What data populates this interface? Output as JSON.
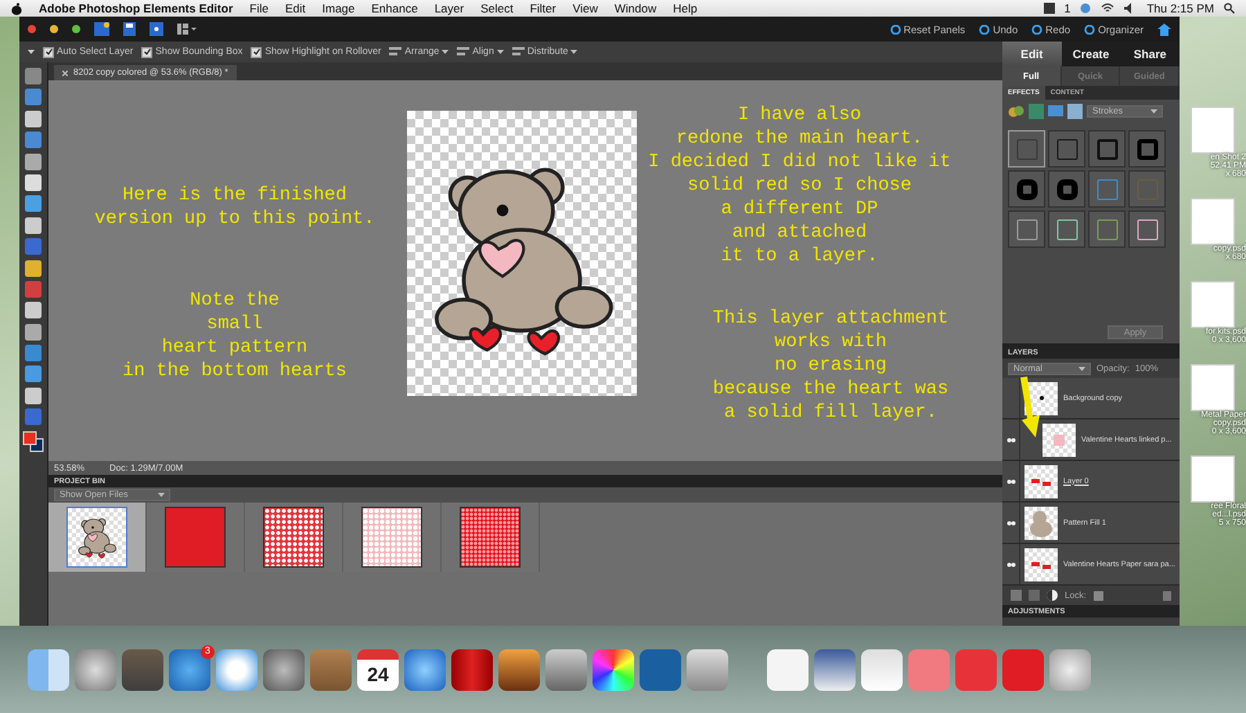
{
  "menubar": {
    "app_name": "Adobe Photoshop Elements Editor",
    "menus": [
      "File",
      "Edit",
      "Image",
      "Enhance",
      "Layer",
      "Select",
      "Filter",
      "View",
      "Window",
      "Help"
    ],
    "status_count": "1",
    "clock": "Thu 2:15 PM"
  },
  "toolbar": {
    "actions": [
      "Reset Panels",
      "Undo",
      "Redo",
      "Organizer"
    ]
  },
  "options_bar": {
    "checkboxes": [
      {
        "label": "Auto Select Layer",
        "checked": true
      },
      {
        "label": "Show Bounding Box",
        "checked": true
      },
      {
        "label": "Show Highlight on Rollover",
        "checked": true
      }
    ],
    "menus": [
      "Arrange",
      "Align",
      "Distribute"
    ]
  },
  "document": {
    "tab_title": "8202 copy colored @ 53.6% (RGB/8) *",
    "zoom": "53.58%",
    "doc_size": "Doc: 1.29M/7.00M"
  },
  "annotations": [
    {
      "text": "Here is the finished\nversion up to this point."
    },
    {
      "text": "Note the\nsmall\nheart pattern\nin the bottom hearts"
    },
    {
      "text": "I have also\nredone the main heart.\nI decided I did not like it\nsolid red so I chose\na different DP\nand attached\nit to a layer."
    },
    {
      "text": "This layer attachment\nworks with\nno erasing\nbecause the heart was\na solid fill layer."
    }
  ],
  "project_bin": {
    "title": "PROJECT BIN",
    "filter": "Show Open Files",
    "items": [
      {
        "kind": "bear",
        "selected": true
      },
      {
        "kind": "solid",
        "selected": false
      },
      {
        "kind": "hearts",
        "selected": false
      },
      {
        "kind": "light-hearts",
        "selected": false
      },
      {
        "kind": "dots",
        "selected": false
      }
    ]
  },
  "mode_tabs": [
    {
      "label": "Edit",
      "selected": true
    },
    {
      "label": "Create",
      "selected": false
    },
    {
      "label": "Share",
      "selected": false
    }
  ],
  "edit_tabs": [
    {
      "label": "Full",
      "selected": true
    },
    {
      "label": "Quick",
      "selected": false
    },
    {
      "label": "Guided",
      "selected": false
    }
  ],
  "effects": {
    "tabs": [
      {
        "label": "EFFECTS",
        "selected": true
      },
      {
        "label": "CONTENT",
        "selected": false
      }
    ],
    "category": "Strokes",
    "apply": "Apply",
    "swatches": [
      {
        "kind": "soft",
        "color": "#3a3a3a",
        "selected": true
      },
      {
        "kind": "thin",
        "color": "#1a1a1a",
        "selected": false
      },
      {
        "kind": "medium",
        "color": "#111111",
        "selected": false
      },
      {
        "kind": "thick",
        "color": "#000000",
        "selected": false
      },
      {
        "kind": "heavy",
        "color": "#000000",
        "selected": false
      },
      {
        "kind": "heavy",
        "color": "#000000",
        "selected": false
      },
      {
        "kind": "thin",
        "color": "#3a8fd0",
        "selected": false
      },
      {
        "kind": "thin",
        "color": "#6e5a3a",
        "selected": false
      },
      {
        "kind": "soft",
        "color": "#9a9a9a",
        "selected": false
      },
      {
        "kind": "thin",
        "color": "#7fc9a0",
        "selected": false
      },
      {
        "kind": "thin",
        "color": "#7aa050",
        "selected": false
      },
      {
        "kind": "thin",
        "color": "#e0a8c0",
        "selected": false
      }
    ]
  },
  "layers": {
    "title": "LAYERS",
    "blend_mode": "Normal",
    "opacity_label": "Opacity:",
    "opacity": "100%",
    "lock_label": "Lock:",
    "items": [
      {
        "name": "Background copy",
        "kind": "bear-outline",
        "visible": false,
        "clipped": false,
        "underlined": false
      },
      {
        "name": "Valentine Hearts linked p...",
        "kind": "pink-patch",
        "visible": true,
        "clipped": true,
        "underlined": false
      },
      {
        "name": "Layer 0",
        "kind": "red-marks",
        "visible": true,
        "clipped": false,
        "underlined": true
      },
      {
        "name": "Pattern Fill 1",
        "kind": "bear-fill",
        "visible": true,
        "clipped": false,
        "underlined": false
      },
      {
        "name": "Valentine Hearts Paper sara pa...",
        "kind": "red-marks",
        "visible": true,
        "clipped": false,
        "underlined": false
      }
    ]
  },
  "adjustments": {
    "title": "ADJUSTMENTS"
  },
  "desktop_files": [
    {
      "lines": [
        "en Shot 2",
        "52.41 PM",
        "x 680"
      ]
    },
    {
      "lines": [
        "copy.psd",
        "x 680"
      ]
    },
    {
      "lines": [
        "for kits.psd",
        "0 x 3,600"
      ]
    },
    {
      "lines": [
        "Metal Paper",
        "copy.psd",
        "0 x 3,600"
      ]
    },
    {
      "lines": [
        "ree Floral",
        "ed...l.psd",
        "5 x 750"
      ]
    }
  ],
  "dock": {
    "app_store_badge": "3",
    "calendar_day": "24"
  }
}
